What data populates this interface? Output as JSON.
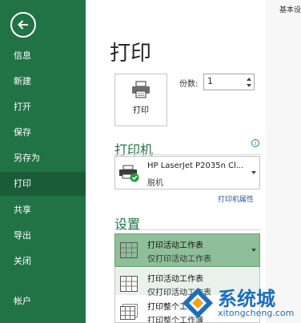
{
  "header": {
    "text": "基本设"
  },
  "sidebar": {
    "items": [
      {
        "label": "信息"
      },
      {
        "label": "新建"
      },
      {
        "label": "打开"
      },
      {
        "label": "保存"
      },
      {
        "label": "另存为"
      },
      {
        "label": "打印",
        "active": true
      },
      {
        "label": "共享"
      },
      {
        "label": "导出"
      },
      {
        "label": "关闭"
      },
      {
        "label": "帐户"
      }
    ]
  },
  "main": {
    "title": "打印",
    "print_button_label": "打印",
    "copies": {
      "label": "份数:",
      "value": "1"
    }
  },
  "printer": {
    "section_title": "打印机",
    "name": "HP LaserJet P2035n Cl...",
    "status": "脱机",
    "properties_link": "打印机属性"
  },
  "settings": {
    "section_title": "设置",
    "selected": {
      "title": "打印活动工作表",
      "subtitle": "仅打印活动工作表"
    },
    "options": [
      {
        "title": "打印活动工作表",
        "subtitle": "仅打印活动工作表"
      },
      {
        "title": "打印整个工作簿",
        "subtitle": "打印整个工作簿"
      }
    ]
  },
  "watermark": {
    "text": "系统城",
    "url": "xitongcheng.com"
  },
  "colors": {
    "accent": "#217346",
    "selected": "#8fbf98",
    "link": "#2b5797"
  }
}
